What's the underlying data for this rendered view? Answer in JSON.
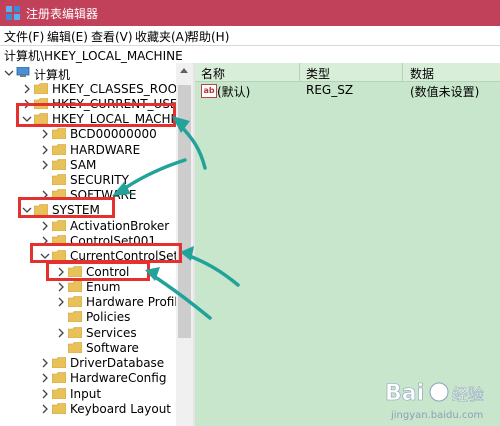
{
  "window": {
    "title": "注册表编辑器",
    "icon": "regedit-icon"
  },
  "menu": [
    "文件(F)",
    "编辑(E)",
    "查看(V)",
    "收藏夹(A)",
    "帮助(H)"
  ],
  "address": "计算机\\HKEY_LOCAL_MACHINE",
  "tree": {
    "nodes": [
      {
        "label": "计算机",
        "expanded": true,
        "icon": "computer-icon"
      },
      {
        "label": "HKEY_CLASSES_ROOT",
        "expanded": false
      },
      {
        "label": "HKEY_CURRENT_USER",
        "expanded": false
      },
      {
        "label": "HKEY_LOCAL_MACHINE",
        "expanded": true
      },
      {
        "label": "BCD00000000",
        "expanded": false
      },
      {
        "label": "HARDWARE",
        "expanded": false
      },
      {
        "label": "SAM",
        "expanded": false
      },
      {
        "label": "SECURITY",
        "expanded": null
      },
      {
        "label": "SOFTWARE",
        "expanded": false
      },
      {
        "label": "SYSTEM",
        "expanded": true
      },
      {
        "label": "ActivationBroker",
        "expanded": false
      },
      {
        "label": "ControlSet001",
        "expanded": false
      },
      {
        "label": "CurrentControlSet",
        "expanded": true
      },
      {
        "label": "Control",
        "expanded": false
      },
      {
        "label": "Enum",
        "expanded": false
      },
      {
        "label": "Hardware Profile",
        "expanded": false
      },
      {
        "label": "Policies",
        "expanded": null
      },
      {
        "label": "Services",
        "expanded": false
      },
      {
        "label": "Software",
        "expanded": null
      },
      {
        "label": "DriverDatabase",
        "expanded": false
      },
      {
        "label": "HardwareConfig",
        "expanded": false
      },
      {
        "label": "Input",
        "expanded": false
      },
      {
        "label": "Keyboard Layout",
        "expanded": false
      }
    ]
  },
  "list": {
    "columns": [
      "名称",
      "类型",
      "数据"
    ],
    "rows": [
      {
        "name": "(默认)",
        "type": "REG_SZ",
        "data": "(数值未设置)",
        "icon": "string-value-icon"
      }
    ]
  },
  "annotations": {
    "highlight_color": "#e53030",
    "arrow_color": "#22a39a"
  },
  "watermark": {
    "brand": "Bai",
    "brand_suffix": "经验",
    "url": "jingyan.baidu.com"
  },
  "colors": {
    "titlebar": "#c2415a",
    "right_pane": "#c8e6cb",
    "folder": "#e8c15a"
  }
}
